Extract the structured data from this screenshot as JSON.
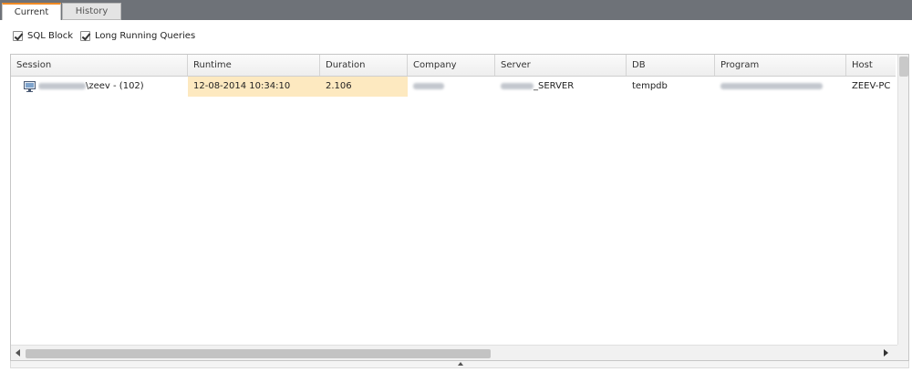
{
  "tabs": [
    {
      "label": "Current",
      "active": true
    },
    {
      "label": "History",
      "active": false
    }
  ],
  "filters": [
    {
      "label": "SQL Block",
      "checked": true
    },
    {
      "label": "Long Running Queries",
      "checked": true
    }
  ],
  "grid": {
    "columns": [
      "Session",
      "Runtime",
      "Duration",
      "Company",
      "Server",
      "DB",
      "Program",
      "Host"
    ],
    "rows": [
      {
        "session": "\\zeev - (102)",
        "runtime": "12-08-2014 10:34:10",
        "duration": "2.106",
        "company": "",
        "server": "_SERVER",
        "db": "tempdb",
        "program": "",
        "host": "ZEEV-PC"
      }
    ]
  },
  "icons": {
    "session": "session-computer-icon",
    "scroll_left": "scroll-left-arrow-icon",
    "scroll_right": "scroll-right-arrow-icon",
    "splitter": "splitter-up-arrow-icon"
  },
  "colors": {
    "active_tab_accent": "#f08a24",
    "highlight_cells": "#fde9c0",
    "tabstrip_background": "#6e7278"
  }
}
